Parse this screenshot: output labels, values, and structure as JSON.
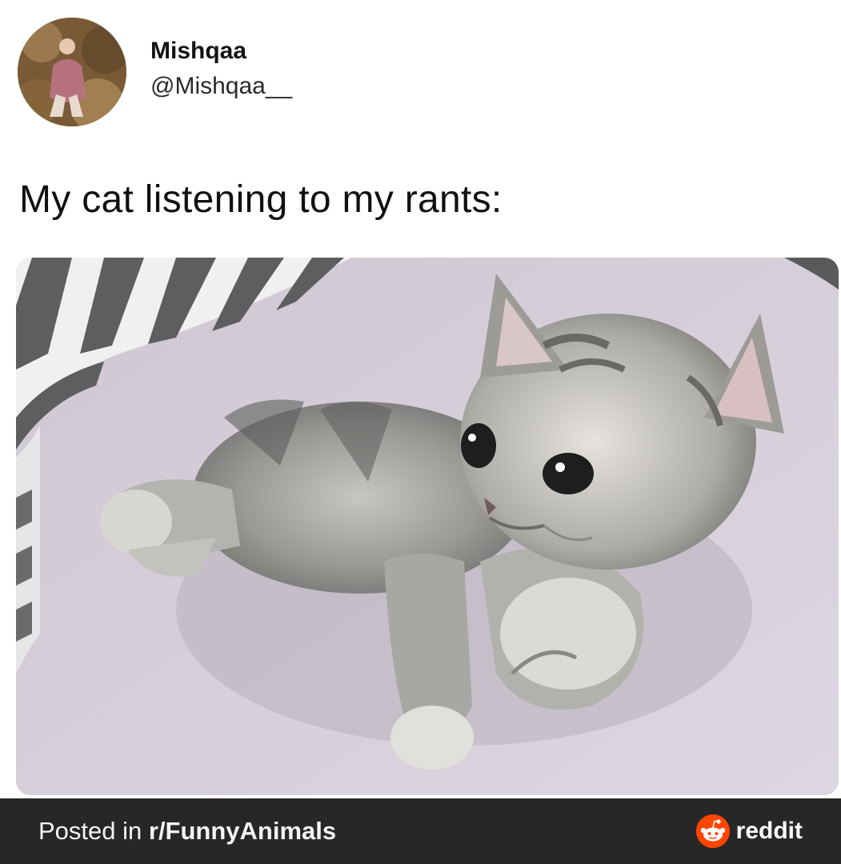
{
  "post": {
    "display_name": "Mishqaa",
    "handle": "@Mishqaa__",
    "text": "My cat listening to my rants:",
    "avatar_icon": "profile-photo",
    "image_subject": "kitten-photo"
  },
  "footer": {
    "prefix": "Posted in ",
    "subreddit": "r/FunnyAnimals",
    "brand": "reddit",
    "brand_icon": "reddit-alien-icon",
    "background_color": "#272727",
    "brand_color": "#ff4500"
  }
}
